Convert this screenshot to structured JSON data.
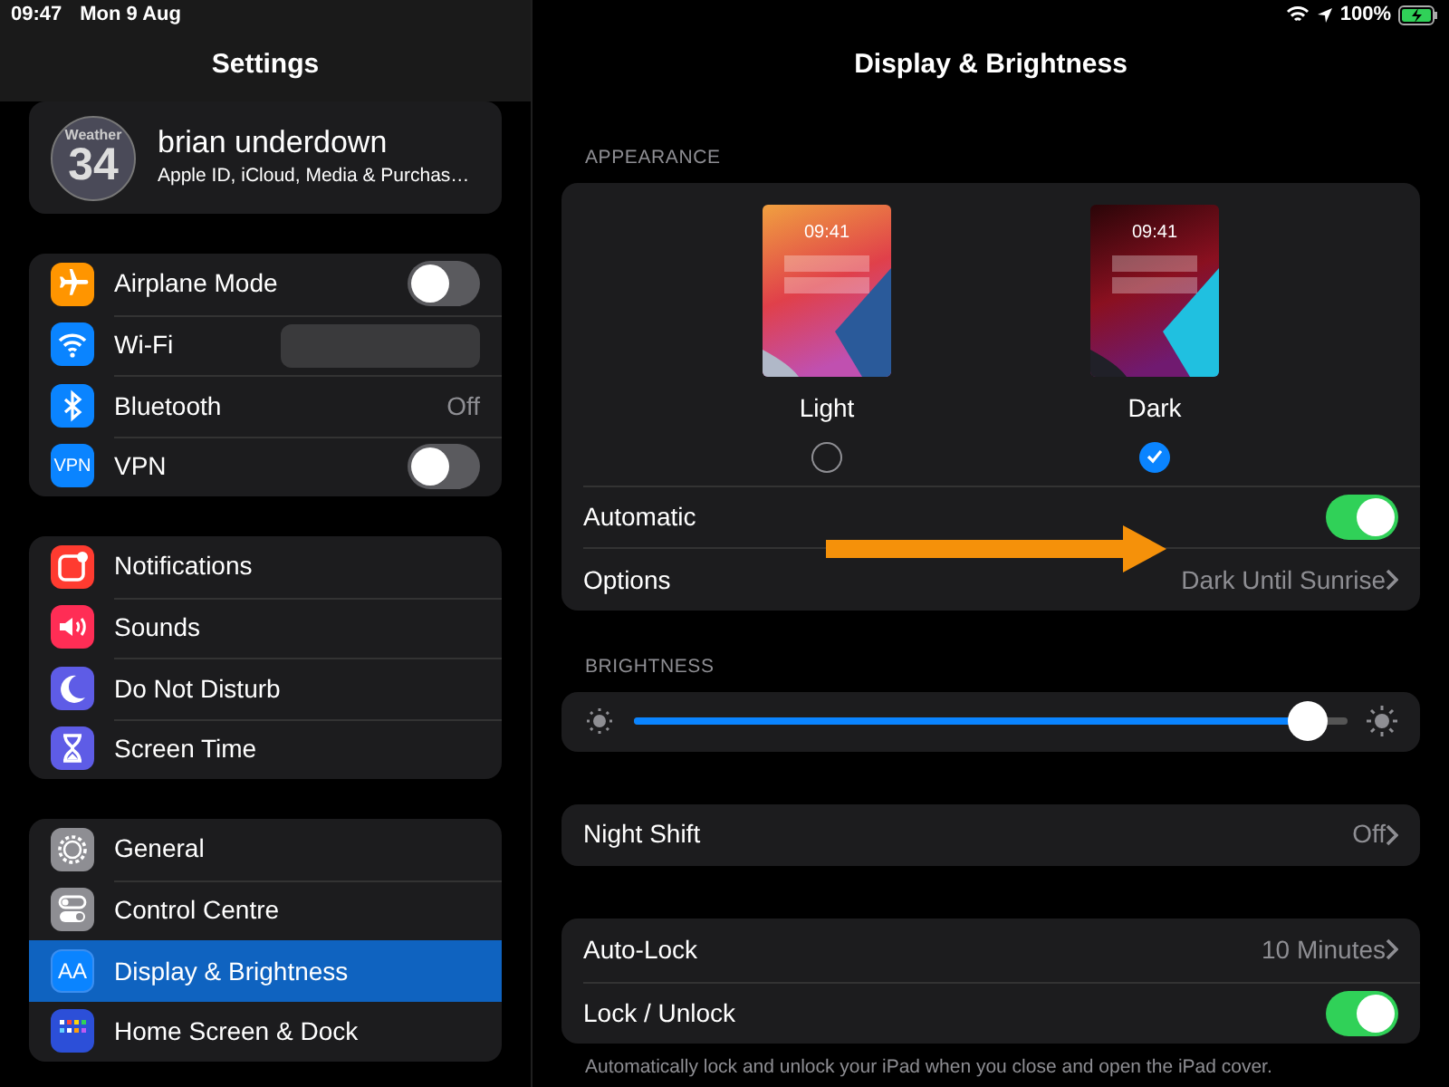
{
  "status_bar": {
    "time": "09:47",
    "date": "Mon 9 Aug",
    "battery": "100%"
  },
  "sidebar": {
    "title": "Settings",
    "profile": {
      "avatar_label": "Weather",
      "avatar_value": "34",
      "name": "brian underdown",
      "subtitle": "Apple ID, iCloud, Media & Purchas…"
    },
    "groups": [
      {
        "items": [
          {
            "label": "Airplane Mode",
            "kind": "toggle",
            "on": false,
            "color": "#ff9500",
            "selected": false
          },
          {
            "label": "Wi-Fi",
            "kind": "redacted",
            "color": "#0a84ff",
            "selected": false
          },
          {
            "label": "Bluetooth",
            "kind": "value",
            "value": "Off",
            "color": "#0a84ff",
            "selected": false
          },
          {
            "label": "VPN",
            "kind": "toggle",
            "on": false,
            "color": "#0a84ff",
            "icon_text": "VPN",
            "selected": false
          }
        ]
      },
      {
        "items": [
          {
            "label": "Notifications",
            "kind": "link",
            "color": "#ff3b30",
            "selected": false
          },
          {
            "label": "Sounds",
            "kind": "link",
            "color": "#ff2d55",
            "selected": false
          },
          {
            "label": "Do Not Disturb",
            "kind": "link",
            "color": "#5e5ce6",
            "selected": false
          },
          {
            "label": "Screen Time",
            "kind": "link",
            "color": "#5e5ce6",
            "selected": false
          }
        ]
      },
      {
        "items": [
          {
            "label": "General",
            "kind": "link",
            "color": "#8e8e93",
            "selected": false
          },
          {
            "label": "Control Centre",
            "kind": "link",
            "color": "#8e8e93",
            "selected": false
          },
          {
            "label": "Display & Brightness",
            "kind": "link",
            "color": "#0a84ff",
            "icon_text": "AA",
            "selected": true
          },
          {
            "label": "Home Screen & Dock",
            "kind": "link",
            "color": "#2c4fd8",
            "selected": false
          }
        ]
      }
    ]
  },
  "detail": {
    "title": "Display & Brightness",
    "appearance": {
      "header": "APPEARANCE",
      "options": [
        {
          "label": "Light",
          "kind": "light",
          "time": "09:41",
          "selected": false
        },
        {
          "label": "Dark",
          "kind": "dark",
          "time": "09:41",
          "selected": true
        }
      ],
      "rows": [
        {
          "label": "Automatic",
          "kind": "toggle",
          "on": true
        },
        {
          "label": "Options",
          "kind": "link",
          "value": "Dark Until Sunrise"
        }
      ]
    },
    "brightness": {
      "header": "BRIGHTNESS",
      "level": 0.97
    },
    "groups": [
      {
        "rows": [
          {
            "label": "Night Shift",
            "kind": "link",
            "value": "Off"
          }
        ]
      },
      {
        "rows": [
          {
            "label": "Auto-Lock",
            "kind": "link",
            "value": "10 Minutes"
          },
          {
            "label": "Lock / Unlock",
            "kind": "toggle",
            "on": true
          }
        ],
        "footer": "Automatically lock and unlock your iPad when you close and open the iPad cover."
      }
    ]
  }
}
